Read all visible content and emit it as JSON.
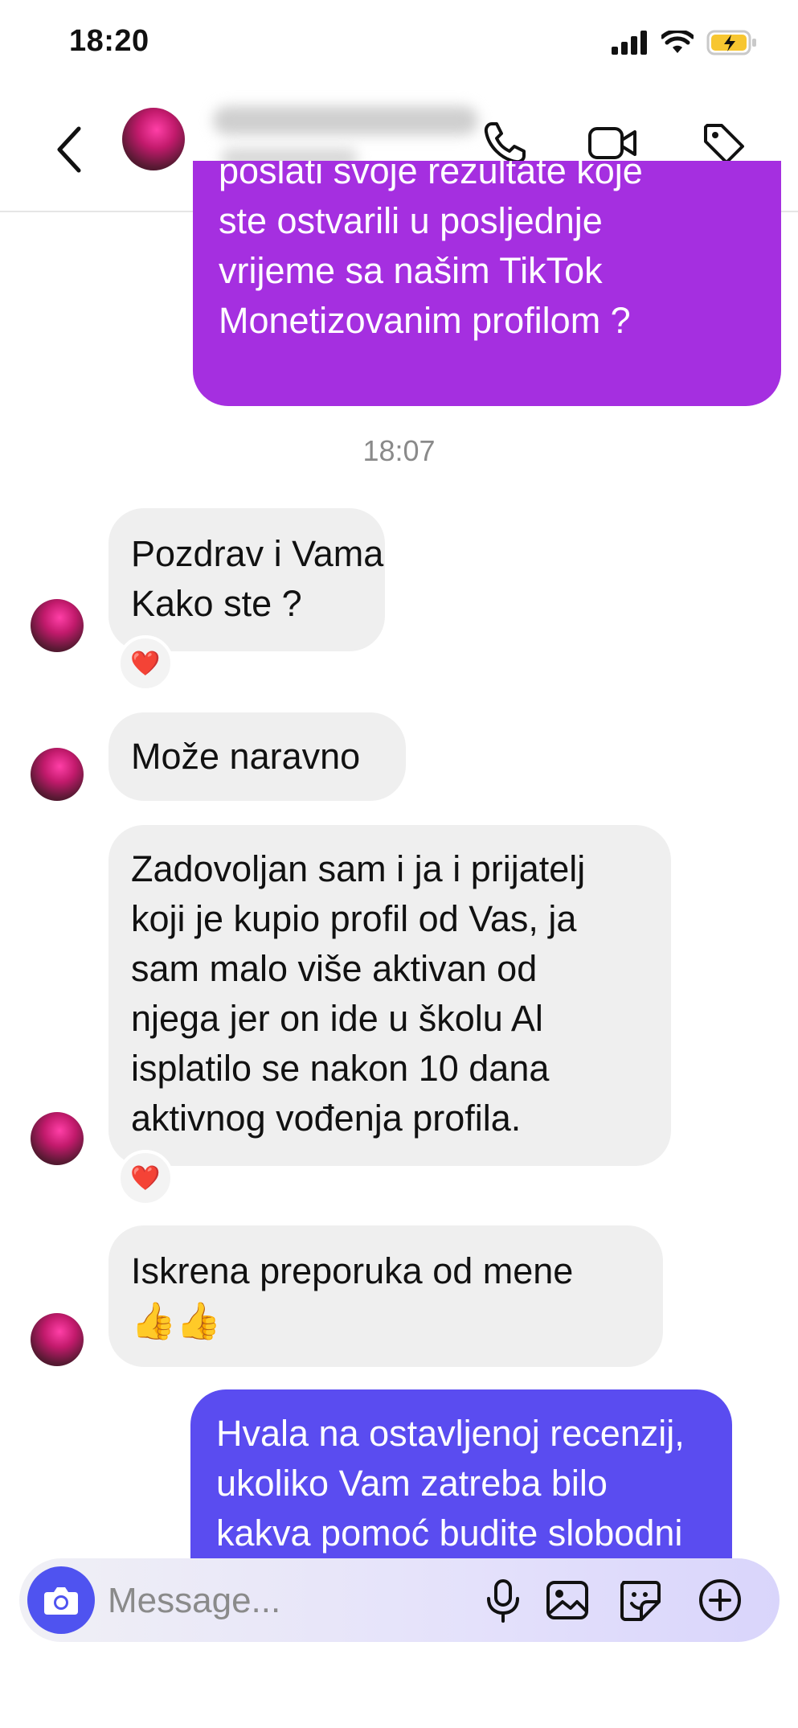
{
  "status_bar": {
    "time": "18:20"
  },
  "conversation": {
    "partial_top_message": {
      "lines": [
        "poslati svoje rezultate koje",
        "ste ostvarili u posljednje",
        "vrijeme sa našim TikTok",
        "Monetizovanim profilom ?"
      ]
    },
    "timestamp": "18:07",
    "messages": [
      {
        "lines": [
          "Pozdrav i Vama",
          "Kako ste ?"
        ],
        "reaction": "❤️"
      },
      {
        "lines": [
          "Može naravno"
        ]
      },
      {
        "lines": [
          "Zadovoljan sam i ja i prijatelj",
          "koji je kupio profil od Vas, ja",
          "sam malo više aktivan od",
          "njega jer on ide u školu Al",
          "isplatilo se nakon 10 dana",
          "aktivnog vođenja profila."
        ],
        "reaction": "❤️"
      },
      {
        "lines": [
          "Iskrena preporuka od mene",
          "👍👍"
        ]
      }
    ],
    "last_outgoing": {
      "lines": [
        "Hvala na ostavljenoj recenzij,",
        "ukoliko Vam zatreba bilo",
        "kakva pomoć budite slobodni"
      ]
    }
  },
  "composer": {
    "placeholder": "Message..."
  },
  "colors": {
    "accent": "#4f53f0",
    "outgoing_top": "#a02fe3",
    "outgoing_bottom": "#5a4cf0",
    "incoming": "#efefef"
  }
}
